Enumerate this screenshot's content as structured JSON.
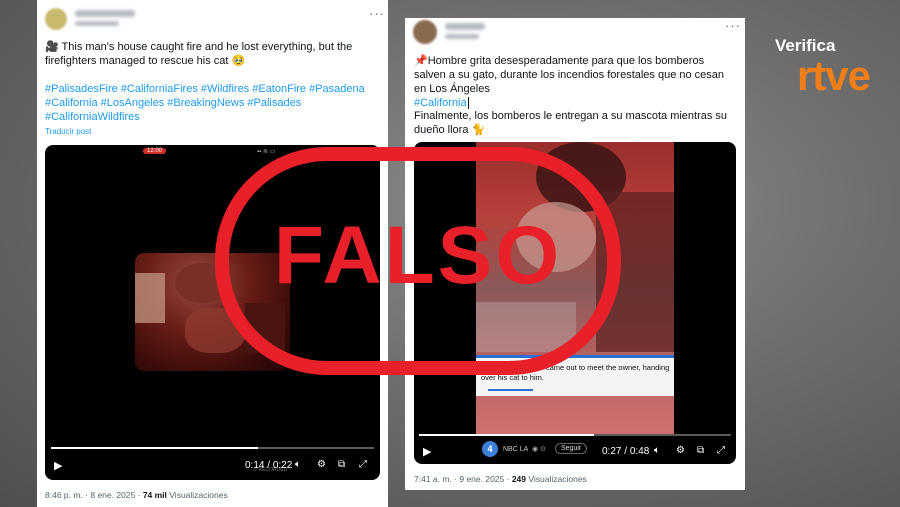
{
  "tweet1": {
    "text": "🎥 This man's house caught fire and he lost everything, but the firefighters managed to rescue his cat 🥹",
    "hashtags": "#PalisadesFire #CaliforniaFires #Wildfires #EatonFire #Pasadena #California #LosAngeles #BreakingNews #Palisades #CaliforniaWildfires",
    "translate_label": "Traducir post",
    "video": {
      "status_time": "12:00",
      "current_time": "0:14",
      "duration": "0:22",
      "progress": 0.64
    },
    "timestamp": "8:46 p. m. · 8 ene. 2025 · ",
    "views_count": "74 mil",
    "views_label": " Visualizaciones"
  },
  "tweet2": {
    "text": "📌Hombre grita desesperadamente para que los bomberos salven a su gato, durante los incendios forestales que no cesan en Los Ángeles",
    "hashtag": "#California",
    "text2": "Finalmente, los bomberos le entregan a su mascota mientras su dueño llora 🐈",
    "video": {
      "caption": "Finally, a firefighter came out to meet the owner, handing over his cat to him.",
      "channel": "NBC LA",
      "follow_label": "Seguir",
      "current_time": "0:27",
      "duration": "0:48",
      "progress": 0.56
    },
    "timestamp": "7:41 a. m. · 9 ene. 2025 · ",
    "views_count": "249",
    "views_label": " Visualizaciones"
  },
  "stamp": {
    "label": "FALSO",
    "color": "#e8202a"
  },
  "brand": {
    "verifica": "Verifica",
    "rtve": "rtve",
    "color": "#f07f1a"
  },
  "icons": [
    "play-icon",
    "volume-icon",
    "settings-icon",
    "pip-icon",
    "fullscreen-icon",
    "more-icon",
    "pin-icon"
  ]
}
